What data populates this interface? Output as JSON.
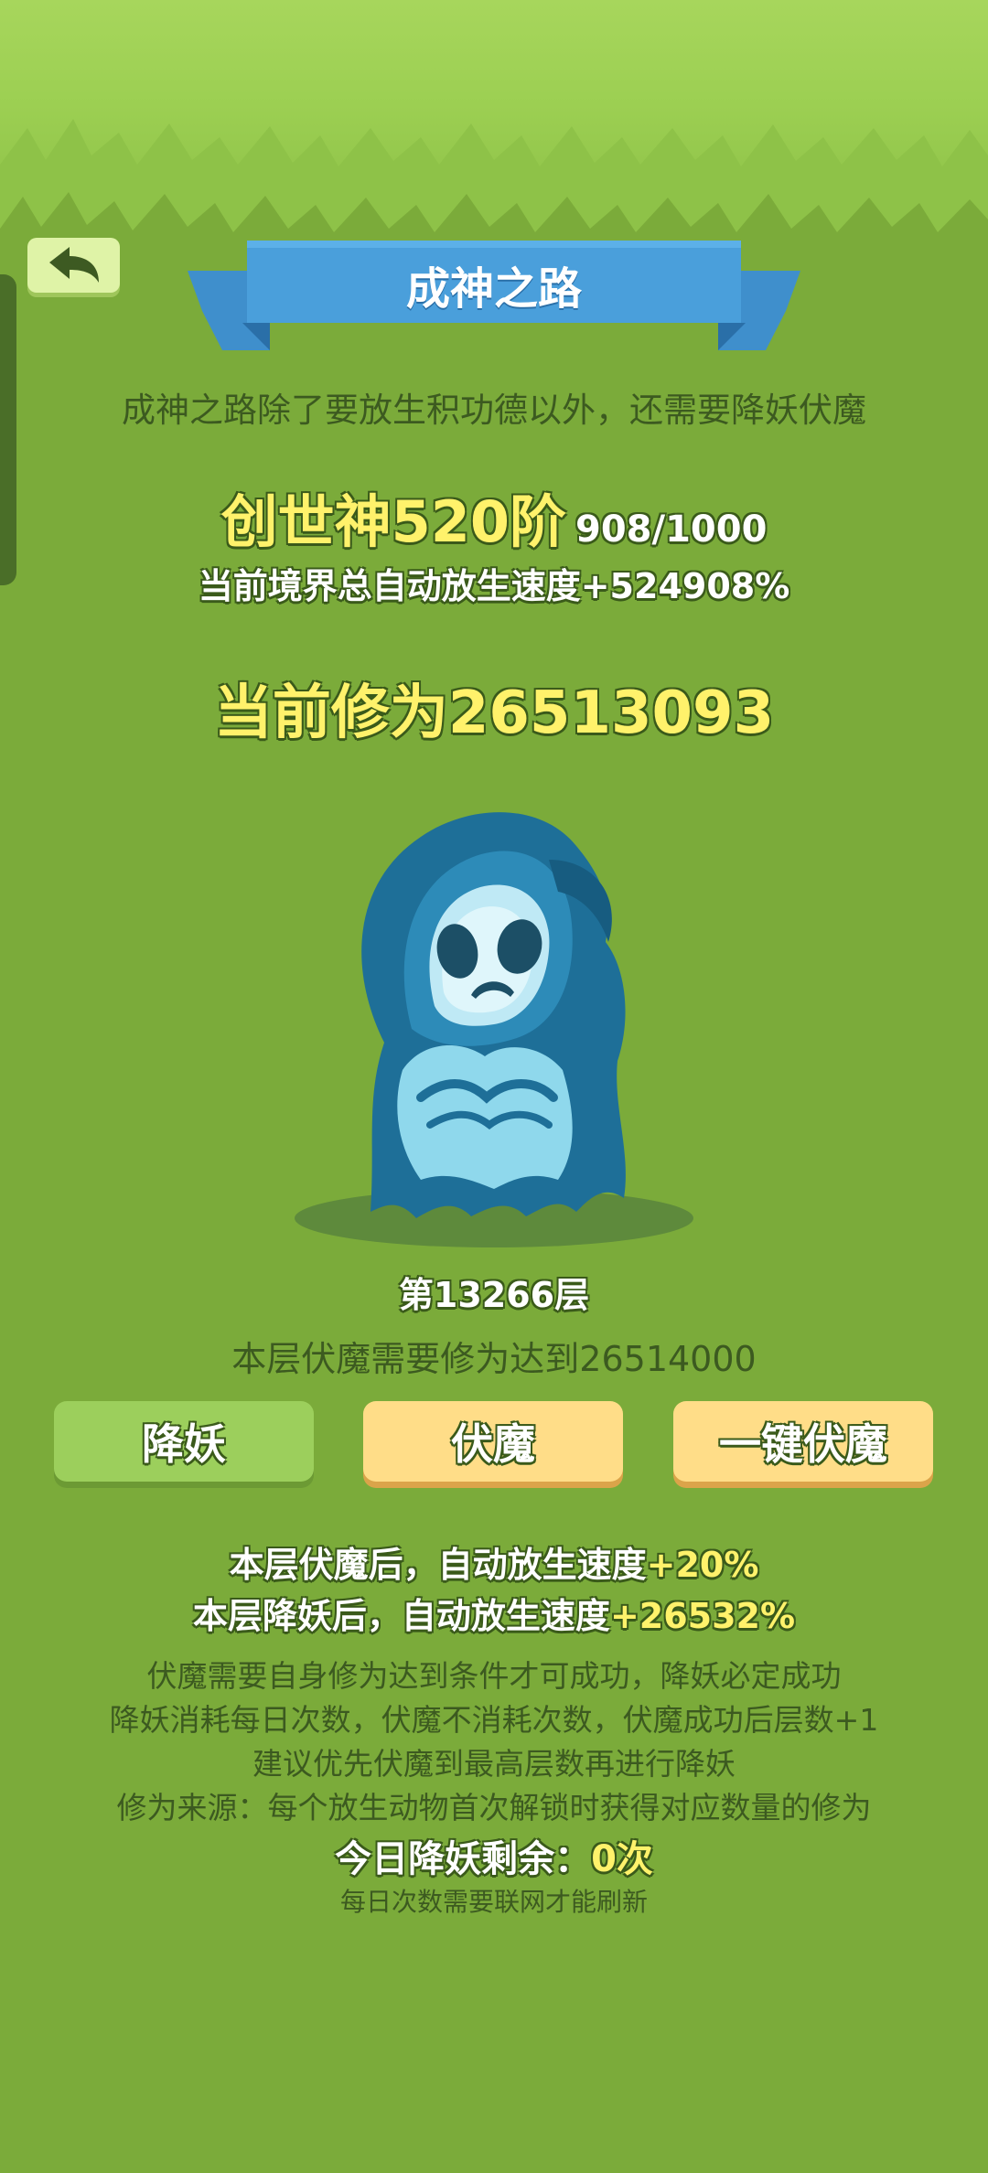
{
  "header": {
    "title": "成神之路"
  },
  "intro": "成神之路除了要放生积功德以外，还需要降妖伏魔",
  "realm": {
    "name": "创世神520阶",
    "progress": "908/1000",
    "speed_text": "当前境界总自动放生速度+524908%"
  },
  "cultivation": "当前修为26513093",
  "monster": {
    "floor": "第13266层",
    "requirement": "本层伏魔需要修为达到26514000"
  },
  "buttons": {
    "subdue": "降妖",
    "conquer": "伏魔",
    "one_click": "一键伏魔"
  },
  "bonuses": {
    "conquer_prefix": "本层伏魔后，自动放生速度",
    "conquer_value": "+20%",
    "subdue_prefix": "本层降妖后，自动放生速度",
    "subdue_value": "+26532%"
  },
  "notes": [
    "伏魔需要自身修为达到条件才可成功，降妖必定成功",
    "降妖消耗每日次数，伏魔不消耗次数，伏魔成功后层数+1",
    "建议优先伏魔到最高层数再进行降妖",
    "修为来源：每个放生动物首次解锁时获得对应数量的修为"
  ],
  "daily": {
    "label": "今日降妖剩余：",
    "value": "0次",
    "refresh_note": "每日次数需要联网才能刷新"
  },
  "icons": {
    "back": "back-arrow-icon",
    "monster": "ghost-reaper"
  },
  "colors": {
    "background": "#7bab3a",
    "highlight": "#fff26b",
    "ribbon": "#4a9fdb",
    "button_green": "#9ccf5c",
    "button_yellow": "#ffdd88"
  }
}
